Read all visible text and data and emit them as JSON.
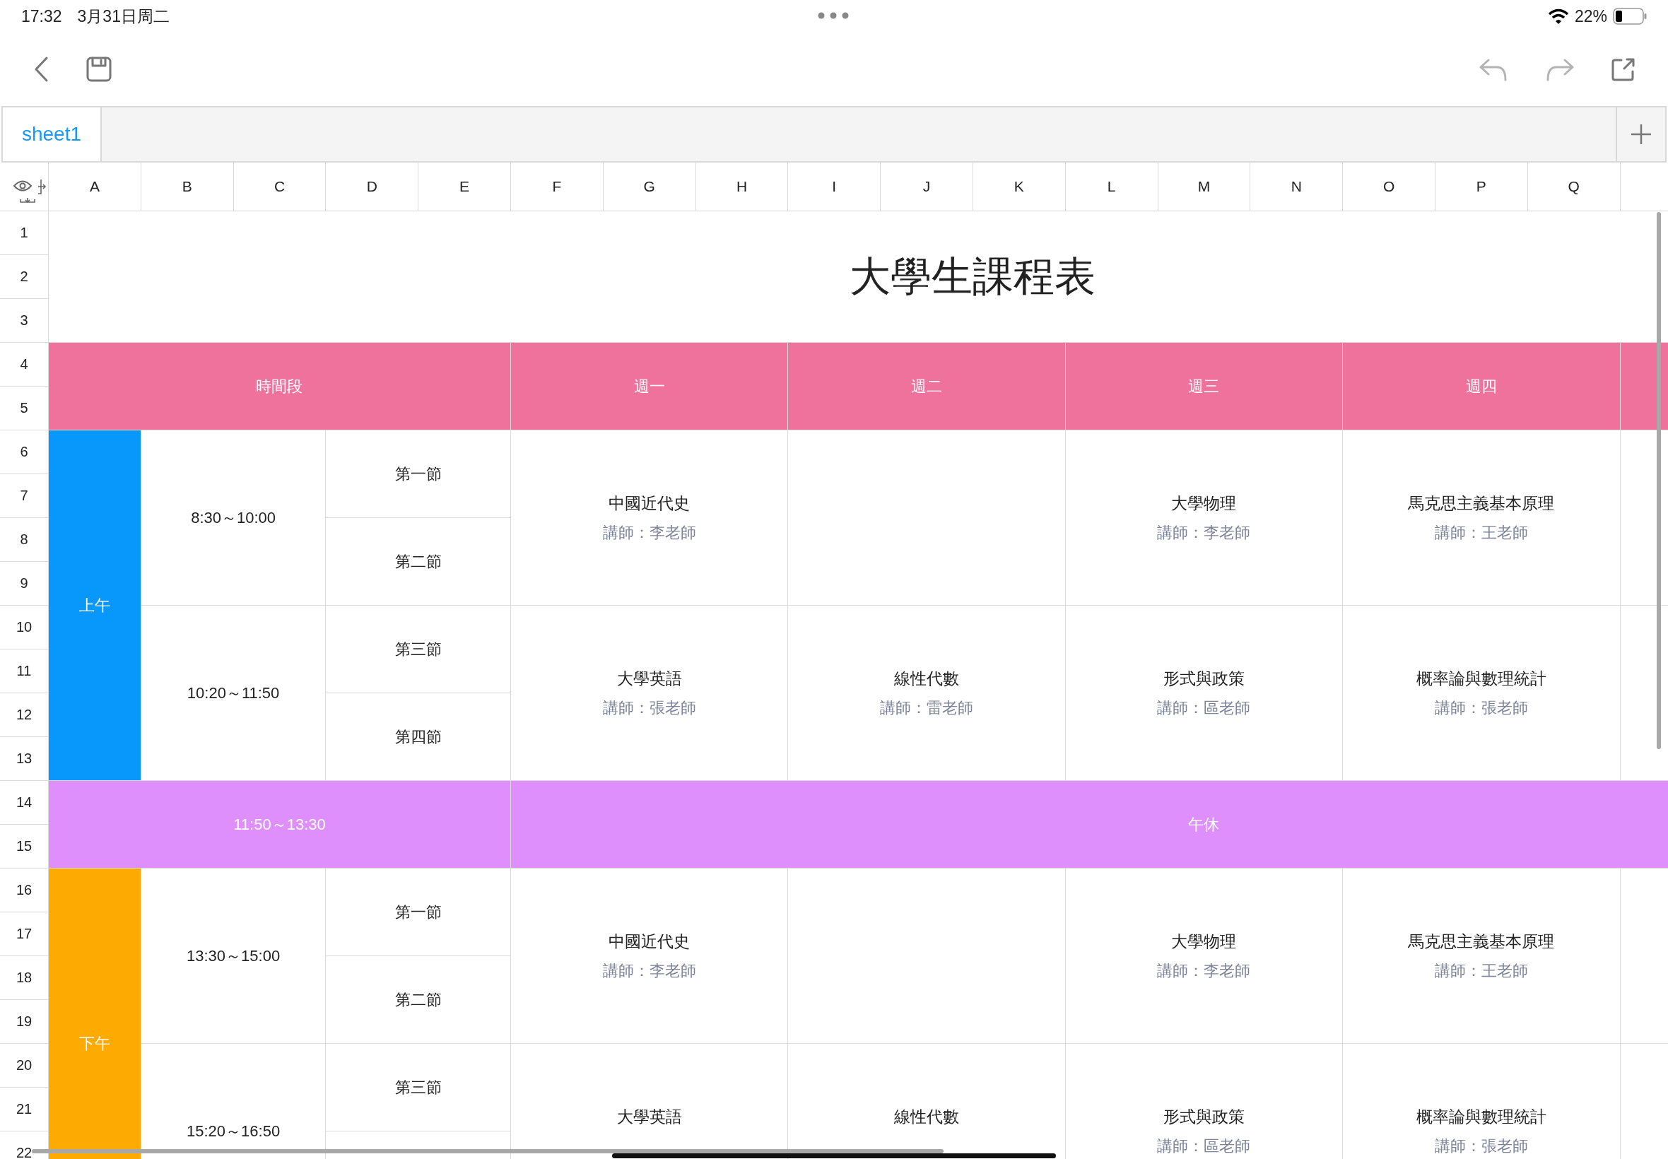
{
  "status_bar": {
    "time": "17:32",
    "date": "3月31日周二",
    "battery": "22%"
  },
  "toolbar": {
    "undo_disabled": true,
    "redo_disabled": true
  },
  "sheet_tabs": [
    {
      "label": "sheet1",
      "selected": true
    }
  ],
  "columns": [
    "A",
    "B",
    "C",
    "D",
    "E",
    "F",
    "G",
    "H",
    "I",
    "J",
    "K",
    "L",
    "M",
    "N",
    "O",
    "P",
    "Q"
  ],
  "row_numbers": [
    "1",
    "2",
    "3",
    "4",
    "5",
    "6",
    "7",
    "8",
    "9",
    "10",
    "11",
    "12",
    "13",
    "14",
    "15",
    "16",
    "17",
    "18",
    "19",
    "20",
    "21",
    "22"
  ],
  "title": "大學生課程表",
  "header": {
    "time_label": "時間段",
    "days": [
      "週一",
      "週二",
      "週三",
      "週四"
    ],
    "color": "#ef729c"
  },
  "blocks": [
    {
      "kind": "session",
      "label": "上午",
      "color": "#0898fb",
      "slots": [
        {
          "time": "8:30～10:00",
          "periods": [
            "第一節",
            "第二節"
          ],
          "courses": [
            {
              "kind": "course",
              "name": "中國近代史",
              "teacher": "講師：李老師"
            },
            {
              "kind": "empty"
            },
            {
              "kind": "course",
              "name": "大學物理",
              "teacher": "講師：李老師"
            },
            {
              "kind": "course",
              "name": "馬克思主義基本原理",
              "teacher": "講師：王老師"
            }
          ]
        },
        {
          "time": "10:20～11:50",
          "periods": [
            "第三節",
            "第四節"
          ],
          "courses": [
            {
              "kind": "course",
              "name": "大學英語",
              "teacher": "講師：張老師"
            },
            {
              "kind": "course",
              "name": "線性代數",
              "teacher": "講師：雷老師"
            },
            {
              "kind": "course",
              "name": "形式與政策",
              "teacher": "講師：區老師"
            },
            {
              "kind": "course",
              "name": "概率論與數理統計",
              "teacher": "講師：張老師"
            }
          ]
        }
      ]
    },
    {
      "kind": "break",
      "time": "11:50～13:30",
      "label": "午休",
      "color": "#de8ffb"
    },
    {
      "kind": "session",
      "label": "下午",
      "color": "#fdab02",
      "slots": [
        {
          "time": "13:30～15:00",
          "periods": [
            "第一節",
            "第二節"
          ],
          "courses": [
            {
              "kind": "course",
              "name": "中國近代史",
              "teacher": "講師：李老師"
            },
            {
              "kind": "empty"
            },
            {
              "kind": "course",
              "name": "大學物理",
              "teacher": "講師：李老師"
            },
            {
              "kind": "course",
              "name": "馬克思主義基本原理",
              "teacher": "講師：王老師"
            }
          ]
        },
        {
          "time": "15:20～16:50",
          "periods": [
            "第三節"
          ],
          "courses": [
            {
              "kind": "course",
              "name": "大學英語"
            },
            {
              "kind": "course",
              "name": "線性代數"
            },
            {
              "kind": "course",
              "name": "形式與政策",
              "teacher": "講師：區老師"
            },
            {
              "kind": "course",
              "name": "概率論與數理統計",
              "teacher": "講師：張老師"
            }
          ]
        }
      ]
    }
  ]
}
